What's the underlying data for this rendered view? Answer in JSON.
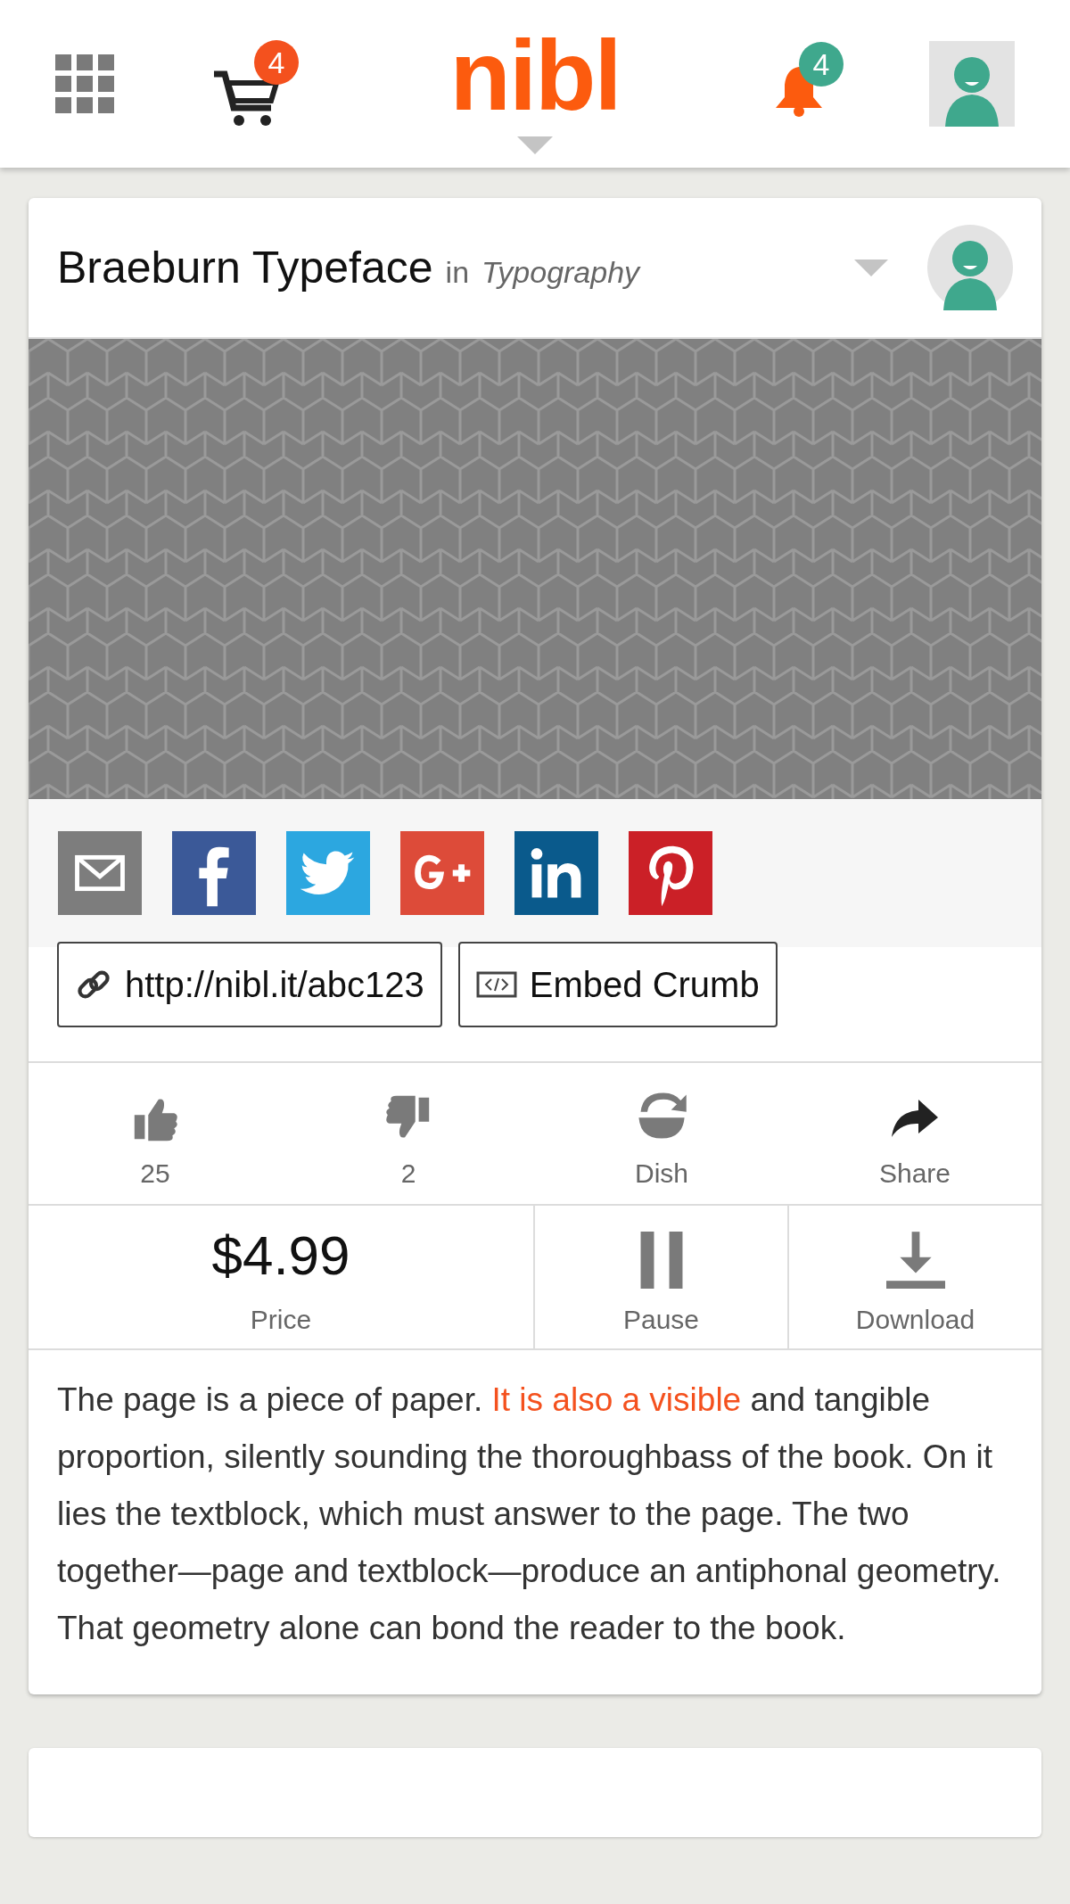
{
  "header": {
    "logo": "nibl",
    "cart_badge": "4",
    "notifications_badge": "4"
  },
  "post": {
    "title": "Braeburn Typeface",
    "category_prefix": "in",
    "category": "Typography",
    "share_buttons": [
      {
        "kind": "email",
        "color": "#7d7d7d"
      },
      {
        "kind": "facebook",
        "color": "#3b5998"
      },
      {
        "kind": "twitter",
        "color": "#2ca7e0"
      },
      {
        "kind": "googleplus",
        "color": "#dd4b39"
      },
      {
        "kind": "linkedin",
        "color": "#0a5a8c"
      },
      {
        "kind": "pinterest",
        "color": "#cb2027"
      }
    ],
    "link_button": "http://nibl.it/abc123",
    "embed_button": "Embed Crumb",
    "actions": [
      {
        "kind": "like",
        "label": "25"
      },
      {
        "kind": "dislike",
        "label": "2"
      },
      {
        "kind": "dish",
        "label": "Dish"
      },
      {
        "kind": "share",
        "label": "Share"
      }
    ],
    "price": {
      "value": "$4.99",
      "label": "Price"
    },
    "controls": [
      {
        "kind": "pause",
        "label": "Pause"
      },
      {
        "kind": "download",
        "label": "Download"
      }
    ],
    "description": [
      {
        "kind": "text",
        "text": "The page is a piece of paper. "
      },
      {
        "kind": "link",
        "text": "It is also a visible"
      },
      {
        "kind": "text",
        "text": " and tangible proportion, silently sounding the thoroughbass of the book. On it lies the textblock, which must answer to the page. The two together—page and textblock—produce an antiphonal geometry. That geometry alone can bond the reader to the book."
      }
    ]
  }
}
